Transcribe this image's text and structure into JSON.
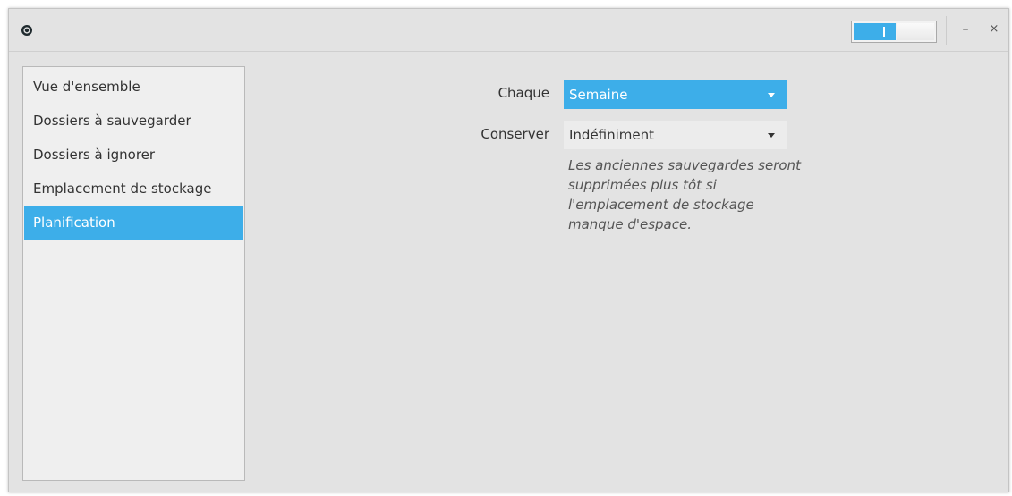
{
  "titlebar": {
    "app_icon": "target-dot-icon",
    "toggle_state": "on",
    "minimize_label": "–",
    "close_label": "×"
  },
  "sidebar": {
    "items": [
      {
        "label": "Vue d'ensemble",
        "selected": false
      },
      {
        "label": "Dossiers à sauvegarder",
        "selected": false
      },
      {
        "label": "Dossiers à ignorer",
        "selected": false
      },
      {
        "label": "Emplacement de stockage",
        "selected": false
      },
      {
        "label": "Planification",
        "selected": true
      }
    ]
  },
  "schedule": {
    "every_label": "Chaque",
    "every_value": "Semaine",
    "keep_label": "Conserver",
    "keep_value": "Indéfiniment",
    "help": "Les anciennes sauvegardes seront supprimées plus tôt si l'emplacement de stockage manque d'espace."
  },
  "colors": {
    "accent": "#3daee9",
    "window_bg": "#e3e3e3",
    "sidebar_bg": "#efefef",
    "text": "#333333"
  }
}
